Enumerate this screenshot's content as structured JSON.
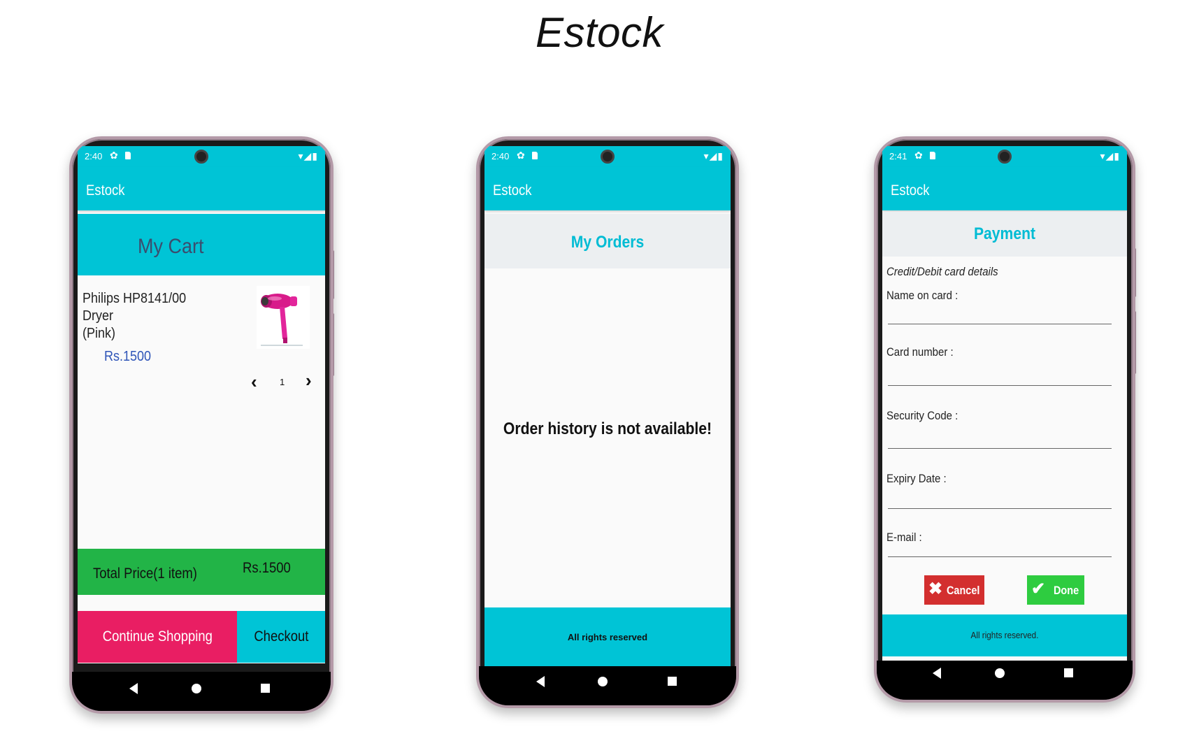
{
  "page_title": "Estock",
  "colors": {
    "primary": "#00c4d6",
    "accent_pink": "#e91e63",
    "total_green": "#22b447",
    "cancel_red": "#d32f2f",
    "done_green": "#2ecc40",
    "price_blue": "#2f55b8"
  },
  "phone1": {
    "status_time": "2:40",
    "app_name": "Estock",
    "header": "My Cart",
    "product": {
      "name_line1": "Philips HP8141/00 Dryer",
      "name_line2": "(Pink)",
      "price": "Rs.1500",
      "image_icon": "hair-dryer-image",
      "quantity": "1"
    },
    "total_label": "Total Price(1 item)",
    "total_value": "Rs.1500",
    "continue_label": "Continue Shopping",
    "checkout_label": "Checkout"
  },
  "phone2": {
    "status_time": "2:40",
    "app_name": "Estock",
    "header": "My Orders",
    "empty_message": "Order history is not available!",
    "footer": "All rights reserved"
  },
  "phone3": {
    "status_time": "2:41",
    "app_name": "Estock",
    "header": "Payment",
    "subtitle": "Credit/Debit card details",
    "fields": {
      "name": "Name on card :",
      "card": "Card number :",
      "security": "Security Code :",
      "expiry": "Expiry Date :",
      "email": "E-mail :"
    },
    "cancel_label": "Cancel",
    "done_label": "Done",
    "footer": "All rights reserved."
  }
}
